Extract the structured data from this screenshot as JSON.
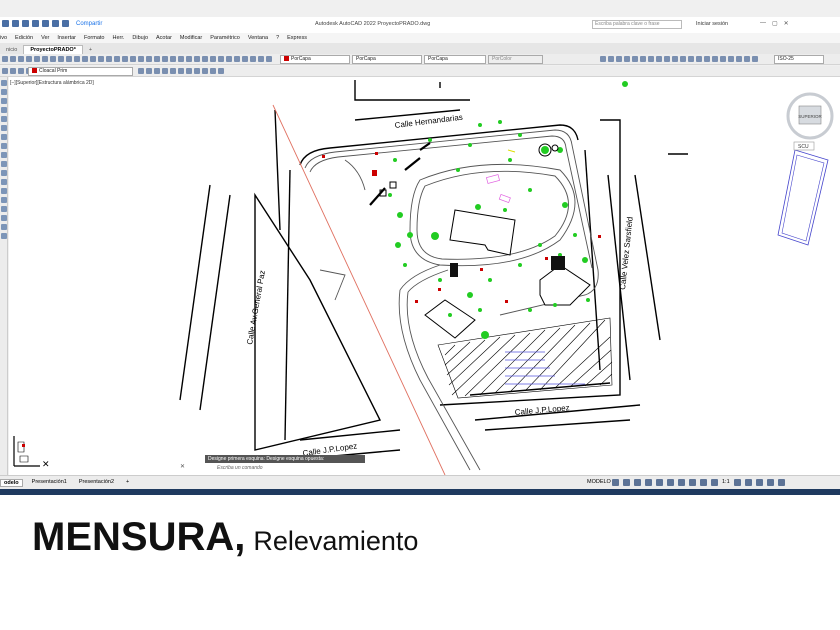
{
  "titlebar": {
    "share": "Compartir",
    "app_title": "Autodesk AutoCAD 2022   ProyectoPRADO.dwg",
    "search_placeholder": "Escriba palabra clave o frase",
    "signin": "Iniciar sesión"
  },
  "menu": [
    "ivo",
    "Edición",
    "Ver",
    "Insertar",
    "Formato",
    "Herr.",
    "Dibujo",
    "Acotar",
    "Modificar",
    "Paramétrico",
    "Ventana",
    "?",
    "Express"
  ],
  "tabs": {
    "start": "nicio",
    "file": "ProyectoPRADO*",
    "add": "+"
  },
  "toolbar": {
    "layer": "Cloacal Prim",
    "color": "PorCapa",
    "linetype": "PorCapa",
    "lineweight": "PorCapa",
    "plotstyle": "PorColor",
    "dimstyle": "ISO-25"
  },
  "view_label": "[−][Superior][Estructura alámbrica 2D]",
  "viewcube_label": "SUPERIOR",
  "viewcube_ucs": "SCU",
  "streets": {
    "hernandarias": "Calle Hernandarias",
    "velez": "Calle Velez Sarsfield",
    "general_paz": "Calle Av.General Paz",
    "jp_lopez_right": "Calle J.P.Lopez",
    "jp_lopez_left": "Calle J.P.Lopez"
  },
  "command": {
    "history": "Designe primera esquina: Designe esquina opuesta:",
    "prompt": "Escriba un comando"
  },
  "status": {
    "tabs": [
      "odelo",
      "Presentación1",
      "Presentación2",
      "+"
    ],
    "model": "MODELO",
    "scale": "1:1"
  },
  "caption": {
    "main": "MENSURA,",
    "sub": "Relevamiento"
  },
  "colors": {
    "accent": "#1a73e8",
    "layer_swatch": "#cc0000",
    "tree": "#22cc22",
    "redline": "#e07060"
  }
}
